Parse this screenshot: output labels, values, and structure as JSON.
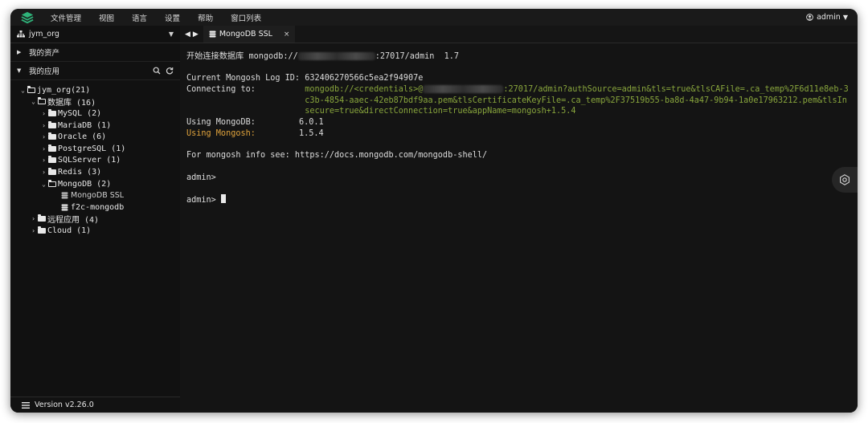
{
  "menubar": {
    "items": [
      "文件管理",
      "视图",
      "语言",
      "设置",
      "帮助",
      "窗口列表"
    ],
    "user": "admin"
  },
  "sidebar": {
    "org": "jym_org",
    "assets_label": "我的资产",
    "apps_label": "我的应用",
    "tree": {
      "root": "jym_org(21)",
      "db": "数据库 (16)",
      "mysql": "MySQL (2)",
      "mariadb": "MariaDB (1)",
      "oracle": "Oracle (6)",
      "postgresql": "PostgreSQL (1)",
      "sqlserver": "SQLServer (1)",
      "redis": "Redis (3)",
      "mongodb": "MongoDB (2)",
      "mongodb_ssl": "MongoDB SSL",
      "f2c_mongodb": "f2c-mongodb",
      "remote": "远程应用 (4)",
      "cloud": "Cloud (1)"
    },
    "version": "Version v2.26.0"
  },
  "tabs": [
    {
      "label": "MongoDB SSL",
      "close": "×"
    }
  ],
  "terminal": {
    "line1_pre": "开始连接数据库 mongodb://",
    "line1_post": ":27017/admin  1.7",
    "logid": "Current Mongosh Log ID: 632406270566c5ea2f94907e",
    "connecting_label": "Connecting to:          ",
    "connecting_pre": "mongodb://<credentials>@",
    "connecting_post": ":27017/admin?authSource=admin&tls=true&tlsCAFile=.ca_temp%2F6d11e8eb-3c3b-4854-aaec-42eb87bdf9aa.pem&tlsCertificateKeyFile=.ca_temp%2F37519b55-ba8d-4a47-9b94-1a0e17963212.pem&tlsInsecure=true&directConnection=true&appName=mongosh+1.5.4",
    "using_mongodb_label": "Using MongoDB:",
    "using_mongodb_val": "6.0.1",
    "using_mongosh_label": "Using Mongosh:",
    "using_mongosh_val": "1.5.4",
    "info": "For mongosh info see: https://docs.mongodb.com/mongodb-shell/",
    "prompt1": "admin>",
    "prompt2": "admin> "
  },
  "colors": {
    "accent_green": "#88a53c",
    "orange": "#e0a33c",
    "logo": "#2fb37a"
  }
}
